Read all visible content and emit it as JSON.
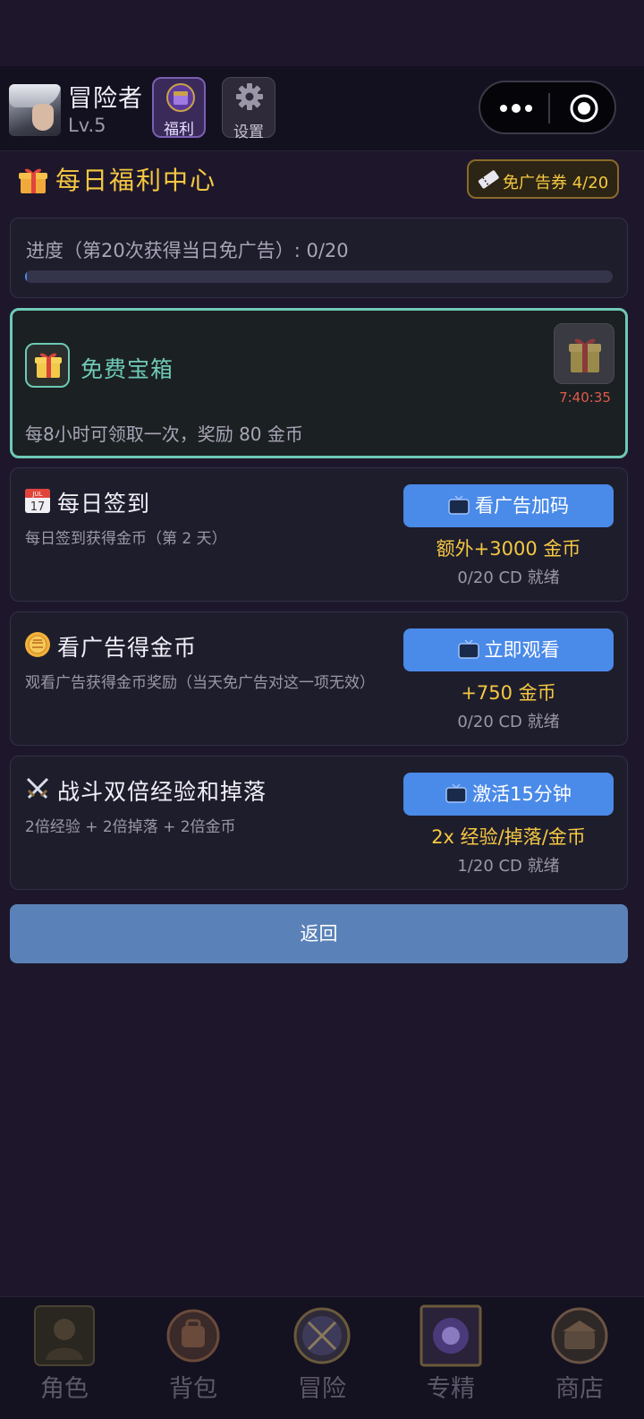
{
  "header": {
    "player_name": "冒险者",
    "player_level": "Lv.5",
    "welfare_label": "福利",
    "settings_label": "设置"
  },
  "page": {
    "title": "每日福利中心",
    "coupon_label": "免广告券 4/20"
  },
  "progress": {
    "label": "进度（第20次获得当日免广告）: 0/20",
    "current": 0,
    "total": 20
  },
  "chest": {
    "title": "免费宝箱",
    "description": "每8小时可领取一次，奖励 80 金币",
    "timer": "7:40:35"
  },
  "tasks": [
    {
      "icon": "calendar-icon",
      "title": "每日签到",
      "subtitle": "每日签到获得金币（第 2 天）",
      "button": "看广告加码",
      "reward": "额外+3000 金币",
      "cd": "0/20  CD 就绪"
    },
    {
      "icon": "coin-icon",
      "title": "看广告得金币",
      "subtitle": "观看广告获得金币奖励（当天免广告对这一项无效）",
      "button": "立即观看",
      "reward": "+750 金币",
      "cd": "0/20  CD 就绪"
    },
    {
      "icon": "crossed-swords-icon",
      "title": "战斗双倍经验和掉落",
      "subtitle": "2倍经验 + 2倍掉落 + 2倍金币",
      "button": "激活15分钟",
      "reward": "2x 经验/掉落/金币",
      "cd": "1/20  CD 就绪"
    }
  ],
  "back_label": "返回",
  "bottom_nav": [
    {
      "label": "角色",
      "icon": "character-icon"
    },
    {
      "label": "背包",
      "icon": "backpack-icon"
    },
    {
      "label": "冒险",
      "icon": "adventure-icon"
    },
    {
      "label": "专精",
      "icon": "mastery-icon"
    },
    {
      "label": "商店",
      "icon": "shop-icon"
    }
  ],
  "colors": {
    "background": "#1e172b",
    "accent_gold": "#f5c842",
    "accent_teal": "#6ec9b6",
    "button_blue": "#4a8ae8",
    "timer_red": "#e05a4a"
  }
}
